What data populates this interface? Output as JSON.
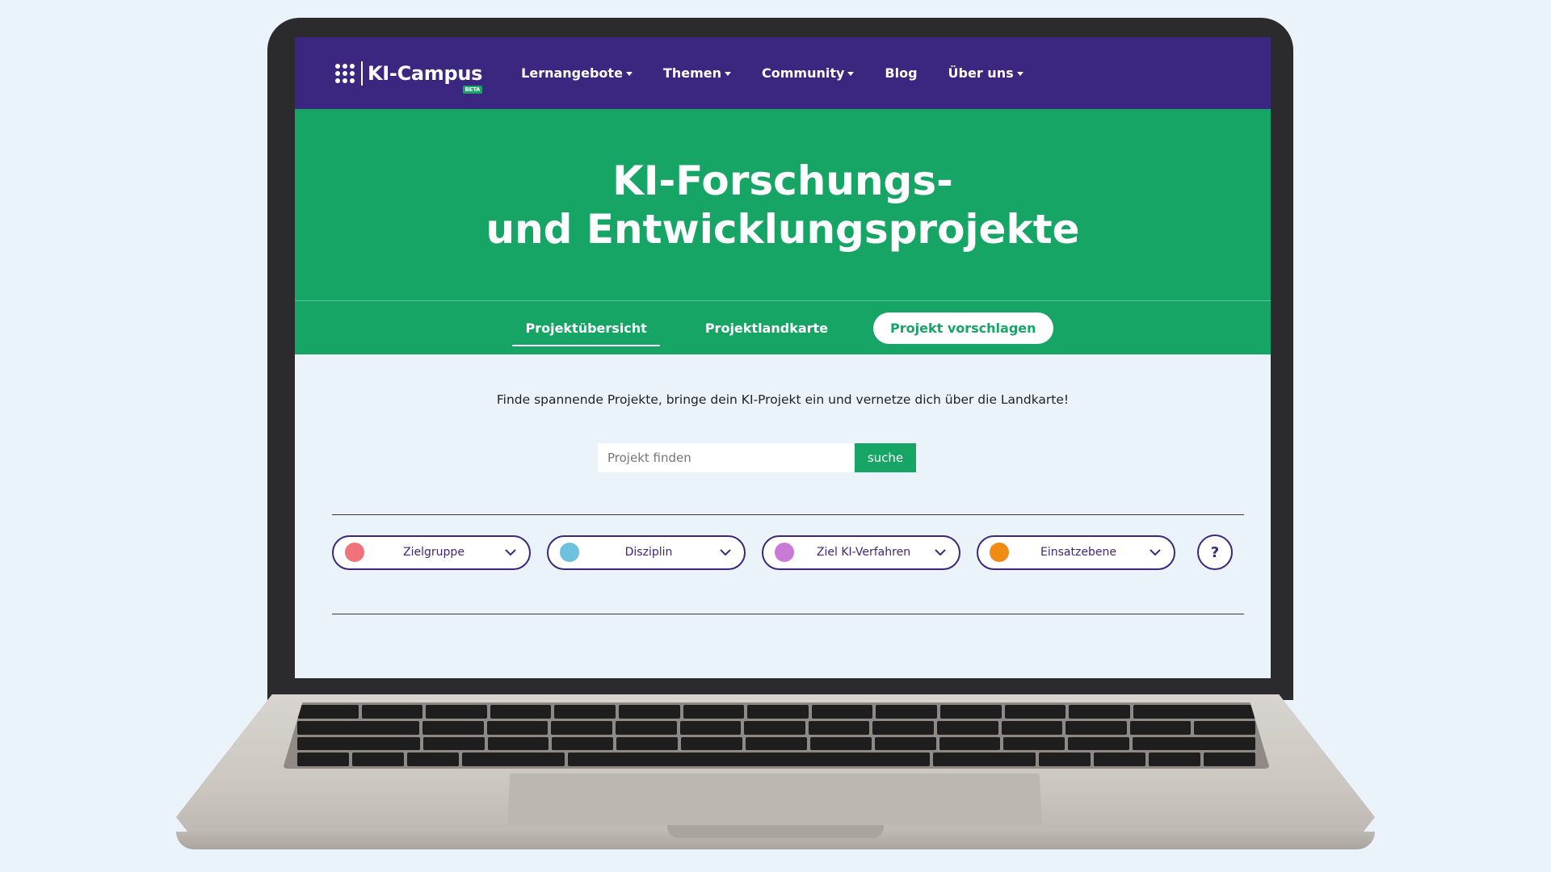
{
  "brand": {
    "name": "KI-Campus",
    "badge": "BETA"
  },
  "nav": {
    "items": [
      {
        "label": "Lernangebote",
        "has_dropdown": true
      },
      {
        "label": "Themen",
        "has_dropdown": true
      },
      {
        "label": "Community",
        "has_dropdown": true
      },
      {
        "label": "Blog",
        "has_dropdown": false
      },
      {
        "label": "Über uns",
        "has_dropdown": true
      }
    ]
  },
  "hero": {
    "title_line1": "KI-Forschungs-",
    "title_line2": "und Entwicklungsprojekte"
  },
  "subnav": {
    "tabs": [
      {
        "label": "Projektübersicht",
        "active": true
      },
      {
        "label": "Projektlandkarte",
        "active": false
      }
    ],
    "cta_label": "Projekt vorschlagen"
  },
  "content": {
    "intro": "Finde spannende Projekte, bringe dein KI-Projekt ein und vernetze dich über die Landkarte!",
    "search": {
      "placeholder": "Projekt finden",
      "button_label": "suche"
    },
    "filters": [
      {
        "label": "Zielgruppe",
        "color": "#f0727a"
      },
      {
        "label": "Disziplin",
        "color": "#6ec1dc"
      },
      {
        "label": "Ziel KI-Verfahren",
        "color": "#c97ad6"
      },
      {
        "label": "Einsatzebene",
        "color": "#f08c13"
      }
    ],
    "help_label": "?"
  },
  "colors": {
    "nav_bg": "#3b2780",
    "accent_green": "#17a566",
    "page_bg": "#eaf2fa"
  }
}
